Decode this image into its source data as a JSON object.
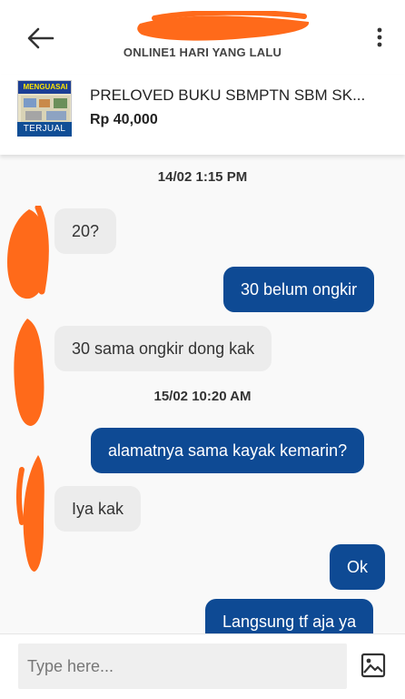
{
  "header": {
    "status": "ONLINE1 HARI YANG LALU"
  },
  "product": {
    "thumb_title": "MENGUASAI IPS",
    "badge": "TERJUAL",
    "name": "PRELOVED BUKU SBMPTN SBM SK...",
    "price": "Rp 40,000"
  },
  "chat": {
    "dates": [
      "14/02  1:15 PM",
      "15/02  10:20 AM"
    ],
    "messages": [
      {
        "from": "them",
        "text": "20?"
      },
      {
        "from": "me",
        "text": "30 belum ongkir"
      },
      {
        "from": "them",
        "text": "30 sama ongkir dong kak"
      },
      {
        "from": "me",
        "text": "alamatnya sama kayak kemarin?"
      },
      {
        "from": "them",
        "text": "Iya kak"
      },
      {
        "from": "me",
        "text": "Ok"
      },
      {
        "from": "me",
        "text": "Langsung tf aja ya"
      }
    ]
  },
  "input": {
    "placeholder": "Type here..."
  },
  "colors": {
    "outgoing_bubble": "#0e4a94",
    "incoming_bubble": "#ececec",
    "redaction": "#ff6a1a"
  }
}
